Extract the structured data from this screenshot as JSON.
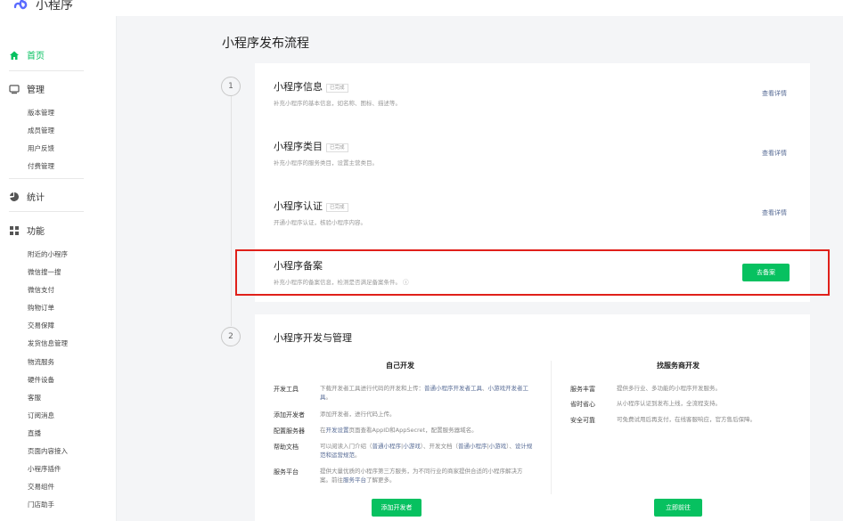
{
  "app": {
    "title": "小程序"
  },
  "sidebar": {
    "home": "首页",
    "manage": "管理",
    "manage_items": [
      "版本管理",
      "成员管理",
      "用户反馈",
      "付费管理"
    ],
    "stats": "统计",
    "features": "功能",
    "feature_items": [
      "附近的小程序",
      "微信搜一搜",
      "微信支付",
      "购物订单",
      "交易保障",
      "发货信息管理",
      "物流服务",
      "硬件设备",
      "客服",
      "订阅消息",
      "直播",
      "页面内容接入",
      "小程序插件",
      "交易组件",
      "门店助手"
    ]
  },
  "main": {
    "title": "小程序发布流程",
    "step1": "1",
    "step2": "2",
    "items": [
      {
        "title": "小程序信息",
        "badge": "已完成",
        "desc": "补充小程序的基本信息，如名称、图标、描述等。",
        "link": "查看详情"
      },
      {
        "title": "小程序类目",
        "badge": "已完成",
        "desc": "补充小程序的服务类目，设置主营类目。",
        "link": "查看详情"
      },
      {
        "title": "小程序认证",
        "badge": "已完成",
        "desc": "开通小程序认证，核验小程序内容。",
        "link": "查看详情"
      },
      {
        "title": "小程序备案",
        "desc": "补充小程序的备案信息，检测是否满足备案条件。",
        "info_icon": "ⓘ",
        "button": "去备案"
      }
    ],
    "dev": {
      "title": "小程序开发与管理",
      "self": {
        "heading": "自己开发",
        "rows": [
          {
            "label": "开发工具",
            "text1": "下载开发者工具进行代码的开发和上传：",
            "link1": "普通小程序开发者工具",
            "sep1": "、",
            "link2": "小游戏开发者工具",
            "end": "。"
          },
          {
            "label": "添加开发者",
            "text": "添加开发者，进行代码上传。"
          },
          {
            "label": "配置服务器",
            "pre": "在",
            "link": "开发设置",
            "post": "页面查看AppID和AppSecret，配置服务器域名。"
          },
          {
            "label": "帮助文档",
            "t1": "可以阅读入门介绍（",
            "l1": "普通小程序",
            "s1": "|",
            "l2": "小游戏",
            "t2": "）、开发文档（",
            "l3": "普通小程序",
            "s2": "|",
            "l4": "小游戏",
            "t3": "）、",
            "l5": "设计规范和运营规范",
            "t4": "。"
          },
          {
            "label": "服务平台",
            "line1": "提供大量优质的小程序第三方服务，为不同行业的商家提供合适的小",
            "pre2": "程序解决方案。前往",
            "link": "服务平台",
            "post2": "了解更多。"
          }
        ],
        "button": "添加开发者"
      },
      "provider": {
        "heading": "找服务商开发",
        "rows": [
          {
            "label": "服务丰富",
            "text": "提供多行业、多功能的小程序开发服务。"
          },
          {
            "label": "省时省心",
            "text": "从小程序认证到发布上线，全流程支持。"
          },
          {
            "label": "安全可靠",
            "text": "可免费试用后再支付，在线客服响应，官方售后保障。"
          }
        ],
        "button": "立即前往"
      }
    }
  }
}
